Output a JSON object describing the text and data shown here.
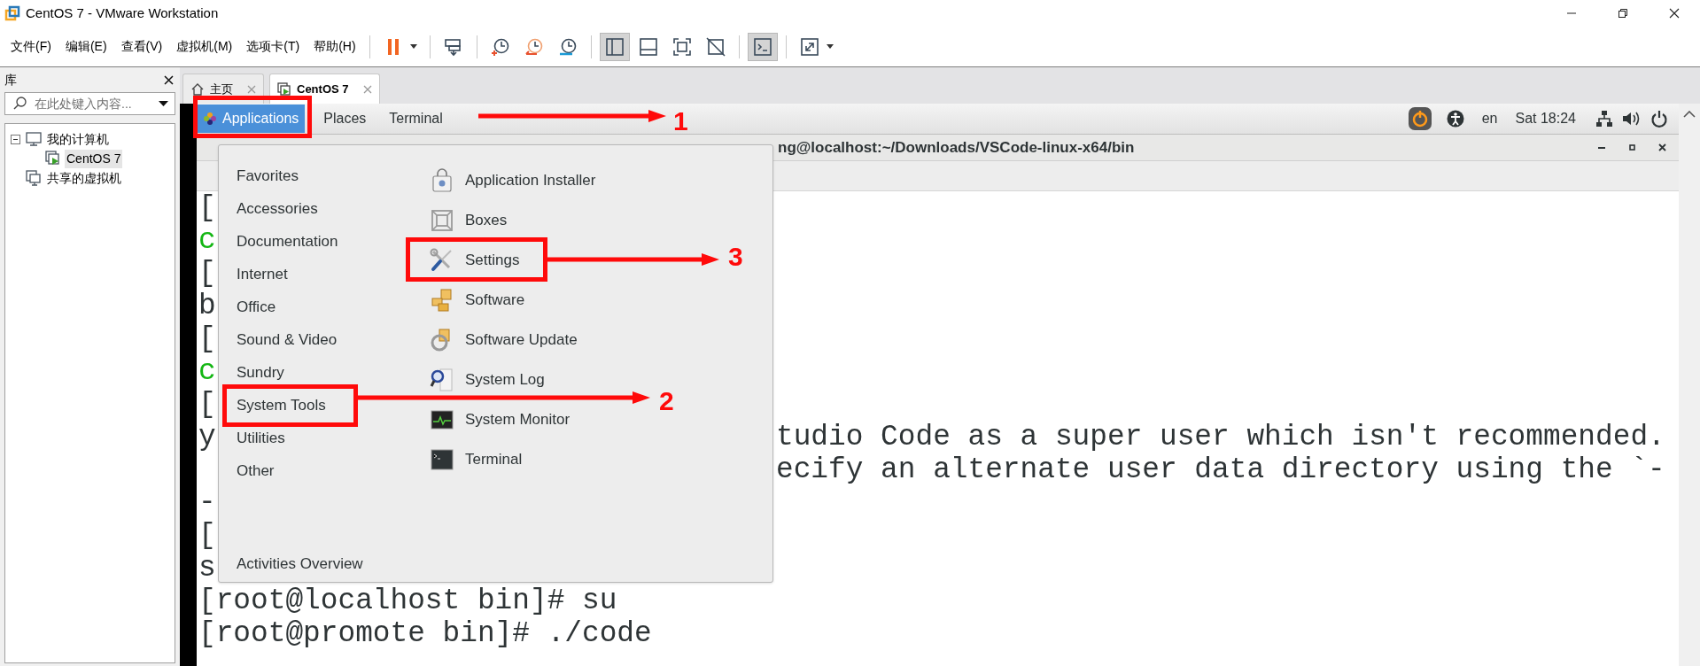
{
  "window": {
    "title": "CentOS 7 - VMware Workstation"
  },
  "menu_bar": [
    "文件(F)",
    "编辑(E)",
    "查看(V)",
    "虚拟机(M)",
    "选项卡(T)",
    "帮助(H)"
  ],
  "toolbar": [
    {
      "kind": "pause",
      "pressed": false
    },
    {
      "kind": "send-keys",
      "pressed": false
    },
    {
      "kind": "snapshot",
      "pressed": false
    },
    {
      "kind": "revert",
      "pressed": false
    },
    {
      "kind": "manage-snapshots",
      "pressed": false
    },
    {
      "kind": "library-view",
      "pressed": true
    },
    {
      "kind": "thumbnail-view",
      "pressed": false
    },
    {
      "kind": "fullscreen",
      "pressed": false
    },
    {
      "kind": "unity",
      "pressed": false
    },
    {
      "kind": "console",
      "pressed": true
    },
    {
      "kind": "stretch",
      "pressed": false
    }
  ],
  "library": {
    "title": "库",
    "search": {
      "placeholder": "在此处键入内容..."
    },
    "tree": [
      {
        "label": "我的计算机",
        "kind": "computer",
        "expanded": true,
        "selected": false,
        "children": [
          {
            "label": "CentOS 7",
            "kind": "vm",
            "selected": true
          }
        ]
      },
      {
        "label": "共享的虚拟机",
        "kind": "shared",
        "selected": false
      }
    ]
  },
  "tabs": [
    {
      "label": "主页",
      "kind": "home",
      "selected": false
    },
    {
      "label": "CentOS 7",
      "kind": "vm",
      "selected": true
    }
  ],
  "gnome_bar": {
    "menus": [
      {
        "label": "Applications",
        "selected": true
      },
      {
        "label": "Places",
        "selected": false
      },
      {
        "label": "Terminal",
        "selected": false
      }
    ],
    "language": "en",
    "clock": "Sat 18:24"
  },
  "terminal": {
    "title": "ng@localhost:~/Downloads/VSCode-linux-x64/bin",
    "lines": [
      {
        "left": "[",
        "color": "#2e3436"
      },
      {
        "left": "c",
        "color": "#13b613"
      },
      {
        "left": "[",
        "color": "#2e3436"
      },
      {
        "left": "b",
        "color": "#2e3436"
      },
      {
        "left": "[",
        "color": "#2e3436"
      },
      {
        "left": "c",
        "color": "#13b613"
      },
      {
        "left": "[",
        "color": "#2e3436"
      },
      {
        "left": "y",
        "right": "tudio Code as a super user which isn't recommended.",
        "color": "#2e3436"
      },
      {
        "right": "ecify an alternate user data directory using the `-",
        "color": "#2e3436"
      },
      {
        "left": "-",
        "color": "#2e3436"
      },
      {
        "left": "[",
        "color": "#2e3436"
      },
      {
        "left": "s",
        "color": "#2e3436"
      },
      {
        "left": "[root@localhost bin]# su",
        "color": "#2e3436"
      },
      {
        "left": "[root@promote bin]# ./code",
        "color": "#2e3436"
      }
    ]
  },
  "app_menu": {
    "categories": [
      {
        "label": "Favorites",
        "selected": false
      },
      {
        "label": "Accessories",
        "selected": false
      },
      {
        "label": "Documentation",
        "selected": false
      },
      {
        "label": "Internet",
        "selected": false
      },
      {
        "label": "Office",
        "selected": false
      },
      {
        "label": "Sound & Video",
        "selected": false
      },
      {
        "label": "Sundry",
        "selected": false
      },
      {
        "label": "System Tools",
        "selected": false
      },
      {
        "label": "Utilities",
        "selected": false
      },
      {
        "label": "Other",
        "selected": false
      }
    ],
    "apps": [
      {
        "label": "Application Installer",
        "kind": "installer"
      },
      {
        "label": "Boxes",
        "kind": "boxes"
      },
      {
        "label": "Settings",
        "kind": "settings"
      },
      {
        "label": "Software",
        "kind": "software"
      },
      {
        "label": "Software Update",
        "kind": "update"
      },
      {
        "label": "System Log",
        "kind": "log"
      },
      {
        "label": "System Monitor",
        "kind": "monitor"
      },
      {
        "label": "Terminal",
        "kind": "terminal"
      }
    ],
    "footer": "Activities Overview"
  },
  "annotations": [
    {
      "label": "1"
    },
    {
      "label": "2"
    },
    {
      "label": "3"
    }
  ]
}
